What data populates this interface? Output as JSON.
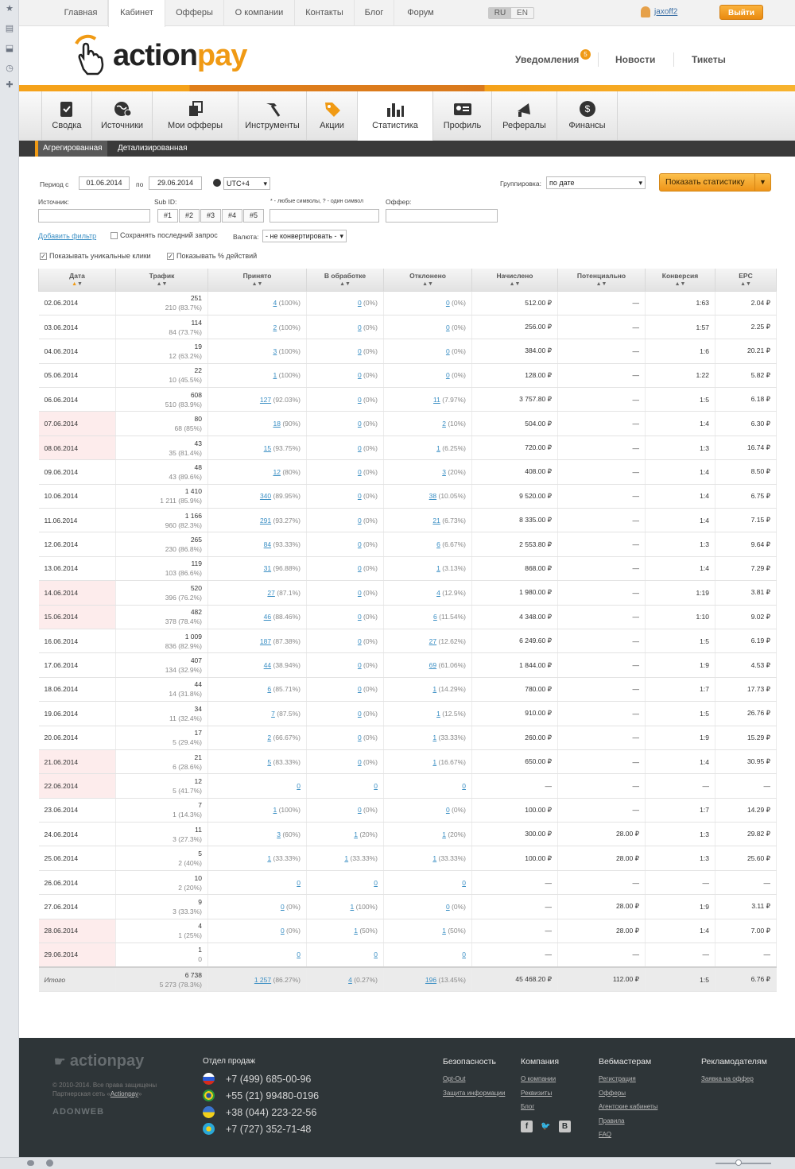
{
  "topnav": {
    "items": [
      "Главная",
      "Кабинет",
      "Офферы",
      "О компании",
      "Контакты",
      "Блог",
      "Форум"
    ],
    "lang": [
      "RU",
      "EN"
    ],
    "user": "jaxoff2",
    "logout": "Выйти"
  },
  "header": {
    "logo_a": "action",
    "logo_b": "pay",
    "links": [
      "Уведомления",
      "Новости",
      "Тикеты"
    ],
    "notif_count": "5"
  },
  "iconnav": [
    "Сводка",
    "Источники",
    "Мои офферы",
    "Инструменты",
    "Акции",
    "Статистика",
    "Профиль",
    "Рефералы",
    "Финансы"
  ],
  "subnav": [
    "Агрегированная",
    "Детализированная"
  ],
  "filters": {
    "period_from_label": "Период с",
    "date_from": "01.06.2014",
    "period_to_label": "по",
    "date_to": "29.06.2014",
    "tz": "UTC+4",
    "grouping_label": "Группировка:",
    "grouping": "по дате",
    "show_btn": "Показать статистику",
    "source_label": "Источник:",
    "subid_label": "Sub ID:",
    "subid_tabs": [
      "#1",
      "#2",
      "#3",
      "#4",
      "#5"
    ],
    "mask_hint": "* - любые символы, ? - один символ",
    "offer_label": "Оффер:",
    "add_filter": "Добавить фильтр",
    "save_last": "Сохранять последний запрос",
    "currency_label": "Валюта:",
    "currency": "- не конвертировать -",
    "unique_clicks": "Показывать уникальные клики",
    "pct_actions": "Показывать % действий"
  },
  "table": {
    "headers": [
      "Дата",
      "Трафик",
      "Принято",
      "В обработке",
      "Отклонено",
      "Начислено",
      "Потенциально",
      "Конверсия",
      "EPC"
    ],
    "rows": [
      {
        "date": "02.06.2014",
        "we": false,
        "t1": "251",
        "t2": "210 (83.7%)",
        "acc": "4",
        "accp": "(100%)",
        "pr": "0",
        "prp": "(0%)",
        "rej": "0",
        "rejp": "(0%)",
        "paid": "512.00 ₽",
        "pot": "—",
        "conv": "1:63",
        "epc": "2.04 ₽"
      },
      {
        "date": "03.06.2014",
        "we": false,
        "t1": "114",
        "t2": "84 (73.7%)",
        "acc": "2",
        "accp": "(100%)",
        "pr": "0",
        "prp": "(0%)",
        "rej": "0",
        "rejp": "(0%)",
        "paid": "256.00 ₽",
        "pot": "—",
        "conv": "1:57",
        "epc": "2.25 ₽"
      },
      {
        "date": "04.06.2014",
        "we": false,
        "t1": "19",
        "t2": "12 (63.2%)",
        "acc": "3",
        "accp": "(100%)",
        "pr": "0",
        "prp": "(0%)",
        "rej": "0",
        "rejp": "(0%)",
        "paid": "384.00 ₽",
        "pot": "—",
        "conv": "1:6",
        "epc": "20.21 ₽"
      },
      {
        "date": "05.06.2014",
        "we": false,
        "t1": "22",
        "t2": "10 (45.5%)",
        "acc": "1",
        "accp": "(100%)",
        "pr": "0",
        "prp": "(0%)",
        "rej": "0",
        "rejp": "(0%)",
        "paid": "128.00 ₽",
        "pot": "—",
        "conv": "1:22",
        "epc": "5.82 ₽"
      },
      {
        "date": "06.06.2014",
        "we": false,
        "t1": "608",
        "t2": "510 (83.9%)",
        "acc": "127",
        "accp": "(92.03%)",
        "pr": "0",
        "prp": "(0%)",
        "rej": "11",
        "rejp": "(7.97%)",
        "paid": "3 757.80 ₽",
        "pot": "—",
        "conv": "1:5",
        "epc": "6.18 ₽"
      },
      {
        "date": "07.06.2014",
        "we": true,
        "t1": "80",
        "t2": "68 (85%)",
        "acc": "18",
        "accp": "(90%)",
        "pr": "0",
        "prp": "(0%)",
        "rej": "2",
        "rejp": "(10%)",
        "paid": "504.00 ₽",
        "pot": "—",
        "conv": "1:4",
        "epc": "6.30 ₽"
      },
      {
        "date": "08.06.2014",
        "we": true,
        "t1": "43",
        "t2": "35 (81.4%)",
        "acc": "15",
        "accp": "(93.75%)",
        "pr": "0",
        "prp": "(0%)",
        "rej": "1",
        "rejp": "(6.25%)",
        "paid": "720.00 ₽",
        "pot": "—",
        "conv": "1:3",
        "epc": "16.74 ₽"
      },
      {
        "date": "09.06.2014",
        "we": false,
        "t1": "48",
        "t2": "43 (89.6%)",
        "acc": "12",
        "accp": "(80%)",
        "pr": "0",
        "prp": "(0%)",
        "rej": "3",
        "rejp": "(20%)",
        "paid": "408.00 ₽",
        "pot": "—",
        "conv": "1:4",
        "epc": "8.50 ₽"
      },
      {
        "date": "10.06.2014",
        "we": false,
        "t1": "1 410",
        "t2": "1 211 (85.9%)",
        "acc": "340",
        "accp": "(89.95%)",
        "pr": "0",
        "prp": "(0%)",
        "rej": "38",
        "rejp": "(10.05%)",
        "paid": "9 520.00 ₽",
        "pot": "—",
        "conv": "1:4",
        "epc": "6.75 ₽"
      },
      {
        "date": "11.06.2014",
        "we": false,
        "t1": "1 166",
        "t2": "960 (82.3%)",
        "acc": "291",
        "accp": "(93.27%)",
        "pr": "0",
        "prp": "(0%)",
        "rej": "21",
        "rejp": "(6.73%)",
        "paid": "8 335.00 ₽",
        "pot": "—",
        "conv": "1:4",
        "epc": "7.15 ₽"
      },
      {
        "date": "12.06.2014",
        "we": false,
        "t1": "265",
        "t2": "230 (86.8%)",
        "acc": "84",
        "accp": "(93.33%)",
        "pr": "0",
        "prp": "(0%)",
        "rej": "6",
        "rejp": "(6.67%)",
        "paid": "2 553.80 ₽",
        "pot": "—",
        "conv": "1:3",
        "epc": "9.64 ₽"
      },
      {
        "date": "13.06.2014",
        "we": false,
        "t1": "119",
        "t2": "103 (86.6%)",
        "acc": "31",
        "accp": "(96.88%)",
        "pr": "0",
        "prp": "(0%)",
        "rej": "1",
        "rejp": "(3.13%)",
        "paid": "868.00 ₽",
        "pot": "—",
        "conv": "1:4",
        "epc": "7.29 ₽"
      },
      {
        "date": "14.06.2014",
        "we": true,
        "t1": "520",
        "t2": "396 (76.2%)",
        "acc": "27",
        "accp": "(87.1%)",
        "pr": "0",
        "prp": "(0%)",
        "rej": "4",
        "rejp": "(12.9%)",
        "paid": "1 980.00 ₽",
        "pot": "—",
        "conv": "1:19",
        "epc": "3.81 ₽"
      },
      {
        "date": "15.06.2014",
        "we": true,
        "t1": "482",
        "t2": "378 (78.4%)",
        "acc": "46",
        "accp": "(88.46%)",
        "pr": "0",
        "prp": "(0%)",
        "rej": "6",
        "rejp": "(11.54%)",
        "paid": "4 348.00 ₽",
        "pot": "—",
        "conv": "1:10",
        "epc": "9.02 ₽"
      },
      {
        "date": "16.06.2014",
        "we": false,
        "t1": "1 009",
        "t2": "836 (82.9%)",
        "acc": "187",
        "accp": "(87.38%)",
        "pr": "0",
        "prp": "(0%)",
        "rej": "27",
        "rejp": "(12.62%)",
        "paid": "6 249.60 ₽",
        "pot": "—",
        "conv": "1:5",
        "epc": "6.19 ₽"
      },
      {
        "date": "17.06.2014",
        "we": false,
        "t1": "407",
        "t2": "134 (32.9%)",
        "acc": "44",
        "accp": "(38.94%)",
        "pr": "0",
        "prp": "(0%)",
        "rej": "69",
        "rejp": "(61.06%)",
        "paid": "1 844.00 ₽",
        "pot": "—",
        "conv": "1:9",
        "epc": "4.53 ₽"
      },
      {
        "date": "18.06.2014",
        "we": false,
        "t1": "44",
        "t2": "14 (31.8%)",
        "acc": "6",
        "accp": "(85.71%)",
        "pr": "0",
        "prp": "(0%)",
        "rej": "1",
        "rejp": "(14.29%)",
        "paid": "780.00 ₽",
        "pot": "—",
        "conv": "1:7",
        "epc": "17.73 ₽"
      },
      {
        "date": "19.06.2014",
        "we": false,
        "t1": "34",
        "t2": "11 (32.4%)",
        "acc": "7",
        "accp": "(87.5%)",
        "pr": "0",
        "prp": "(0%)",
        "rej": "1",
        "rejp": "(12.5%)",
        "paid": "910.00 ₽",
        "pot": "—",
        "conv": "1:5",
        "epc": "26.76 ₽"
      },
      {
        "date": "20.06.2014",
        "we": false,
        "t1": "17",
        "t2": "5 (29.4%)",
        "acc": "2",
        "accp": "(66.67%)",
        "pr": "0",
        "prp": "(0%)",
        "rej": "1",
        "rejp": "(33.33%)",
        "paid": "260.00 ₽",
        "pot": "—",
        "conv": "1:9",
        "epc": "15.29 ₽"
      },
      {
        "date": "21.06.2014",
        "we": true,
        "t1": "21",
        "t2": "6 (28.6%)",
        "acc": "5",
        "accp": "(83.33%)",
        "pr": "0",
        "prp": "(0%)",
        "rej": "1",
        "rejp": "(16.67%)",
        "paid": "650.00 ₽",
        "pot": "—",
        "conv": "1:4",
        "epc": "30.95 ₽"
      },
      {
        "date": "22.06.2014",
        "we": true,
        "t1": "12",
        "t2": "5 (41.7%)",
        "acc": "0",
        "accp": "",
        "pr": "0",
        "prp": "",
        "rej": "0",
        "rejp": "",
        "paid": "—",
        "pot": "—",
        "conv": "—",
        "epc": "—"
      },
      {
        "date": "23.06.2014",
        "we": false,
        "t1": "7",
        "t2": "1 (14.3%)",
        "acc": "1",
        "accp": "(100%)",
        "pr": "0",
        "prp": "(0%)",
        "rej": "0",
        "rejp": "(0%)",
        "paid": "100.00 ₽",
        "pot": "—",
        "conv": "1:7",
        "epc": "14.29 ₽"
      },
      {
        "date": "24.06.2014",
        "we": false,
        "t1": "11",
        "t2": "3 (27.3%)",
        "acc": "3",
        "accp": "(60%)",
        "pr": "1",
        "prp": "(20%)",
        "rej": "1",
        "rejp": "(20%)",
        "paid": "300.00 ₽",
        "pot": "28.00 ₽",
        "conv": "1:3",
        "epc": "29.82 ₽"
      },
      {
        "date": "25.06.2014",
        "we": false,
        "t1": "5",
        "t2": "2 (40%)",
        "acc": "1",
        "accp": "(33.33%)",
        "pr": "1",
        "prp": "(33.33%)",
        "rej": "1",
        "rejp": "(33.33%)",
        "paid": "100.00 ₽",
        "pot": "28.00 ₽",
        "conv": "1:3",
        "epc": "25.60 ₽"
      },
      {
        "date": "26.06.2014",
        "we": false,
        "t1": "10",
        "t2": "2 (20%)",
        "acc": "0",
        "accp": "",
        "pr": "0",
        "prp": "",
        "rej": "0",
        "rejp": "",
        "paid": "—",
        "pot": "—",
        "conv": "—",
        "epc": "—"
      },
      {
        "date": "27.06.2014",
        "we": false,
        "t1": "9",
        "t2": "3 (33.3%)",
        "acc": "0",
        "accp": "(0%)",
        "pr": "1",
        "prp": "(100%)",
        "rej": "0",
        "rejp": "(0%)",
        "paid": "—",
        "pot": "28.00 ₽",
        "conv": "1:9",
        "epc": "3.11 ₽"
      },
      {
        "date": "28.06.2014",
        "we": true,
        "t1": "4",
        "t2": "1 (25%)",
        "acc": "0",
        "accp": "(0%)",
        "pr": "1",
        "prp": "(50%)",
        "rej": "1",
        "rejp": "(50%)",
        "paid": "—",
        "pot": "28.00 ₽",
        "conv": "1:4",
        "epc": "7.00 ₽"
      },
      {
        "date": "29.06.2014",
        "we": true,
        "t1": "1",
        "t2": "0",
        "acc": "0",
        "accp": "",
        "pr": "0",
        "prp": "",
        "rej": "0",
        "rejp": "",
        "paid": "—",
        "pot": "—",
        "conv": "—",
        "epc": "—"
      }
    ],
    "total": {
      "date": "Итого",
      "t1": "6 738",
      "t2": "5 273 (78.3%)",
      "acc": "1 257",
      "accp": "(86.27%)",
      "pr": "4",
      "prp": "(0.27%)",
      "rej": "196",
      "rejp": "(13.45%)",
      "paid": "45 468.20 ₽",
      "pot": "112.00 ₽",
      "conv": "1:5",
      "epc": "6.76 ₽"
    }
  },
  "footer": {
    "logo": "actionpay",
    "copyright": "© 2010-2014. Все права защищены",
    "partner": "Партнерская сеть «",
    "partner_link": "Actionpay",
    "partner_end": "»",
    "adonweb": "ADONWEB",
    "sales_title": "Отдел продаж",
    "phones": [
      "+7 (499) 685-00-96",
      "+55 (21) 99480-0196",
      "+38 (044) 223-22-56",
      "+7 (727) 352-71-48"
    ],
    "cols": [
      {
        "title": "Безопасность",
        "links": [
          "Opt-Out",
          "Защита информации"
        ]
      },
      {
        "title": "Компания",
        "links": [
          "О компании",
          "Реквизиты",
          "Блог"
        ]
      },
      {
        "title": "Вебмастерам",
        "links": [
          "Регистрация",
          "Офферы",
          "Агентские кабинеты",
          "Правила",
          "FAQ"
        ]
      },
      {
        "title": "Рекламодателям",
        "links": [
          "Заявка на оффер"
        ]
      }
    ],
    "social": [
      "f",
      "t",
      "B"
    ]
  }
}
